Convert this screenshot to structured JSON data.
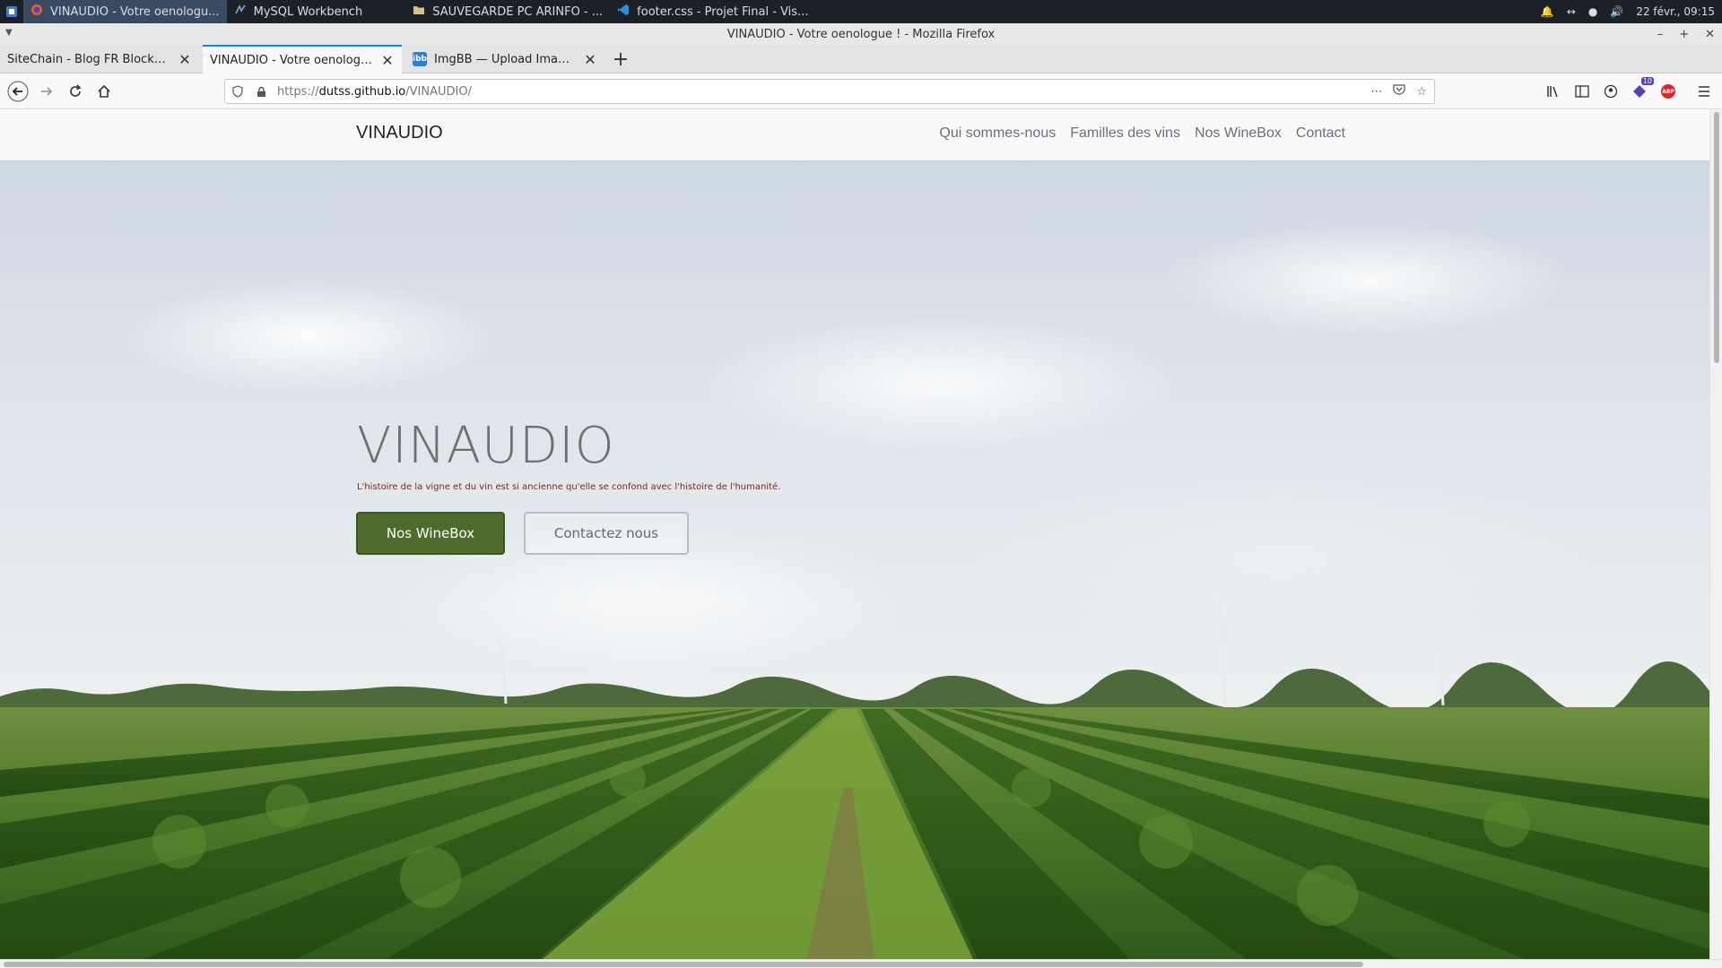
{
  "os": {
    "tasks": [
      {
        "label": "VINAUDIO - Votre oenologu...",
        "icon": "firefox-icon",
        "active": true
      },
      {
        "label": "MySQL Workbench",
        "icon": "mysql-workbench-icon",
        "active": false
      },
      {
        "label": "SAUVEGARDE PC ARINFO - ...",
        "icon": "folder-icon",
        "active": false
      },
      {
        "label": "footer.css - Projet Final - Vis...",
        "icon": "vscode-icon",
        "active": false
      }
    ],
    "clock": "22 févr., 09:15"
  },
  "window": {
    "title": "VINAUDIO - Votre oenologue ! - Mozilla Firefox"
  },
  "tabs": [
    {
      "title": "SiteChain - Blog FR Blockchain",
      "active": false
    },
    {
      "title": "VINAUDIO - Votre oenologue !",
      "active": true
    },
    {
      "title": "ImgBB — Upload Image — H",
      "active": false,
      "favicon": "ibb"
    }
  ],
  "urlbar": {
    "prefix": "https://",
    "host": "dutss.github.io",
    "path": "/VINAUDIO/"
  },
  "extensions": {
    "badge_count": "10",
    "abp_label": "ABP"
  },
  "page": {
    "brand": "VINAUDIO",
    "nav": [
      "Qui sommes-nous",
      "Familles des vins",
      "Nos WineBox",
      "Contact"
    ],
    "hero": {
      "title": "VINAUDIO",
      "subtitle": "L'histoire de la vigne et du vin est si ancienne qu'elle se confond avec l'histoire de l'humanité.",
      "primary_button": "Nos WineBox",
      "secondary_button": "Contactez nous"
    },
    "colors": {
      "primary_button": "#4f6b2c",
      "subtitle": "#8b1a1a",
      "accent_tab": "#0a84ff"
    }
  }
}
